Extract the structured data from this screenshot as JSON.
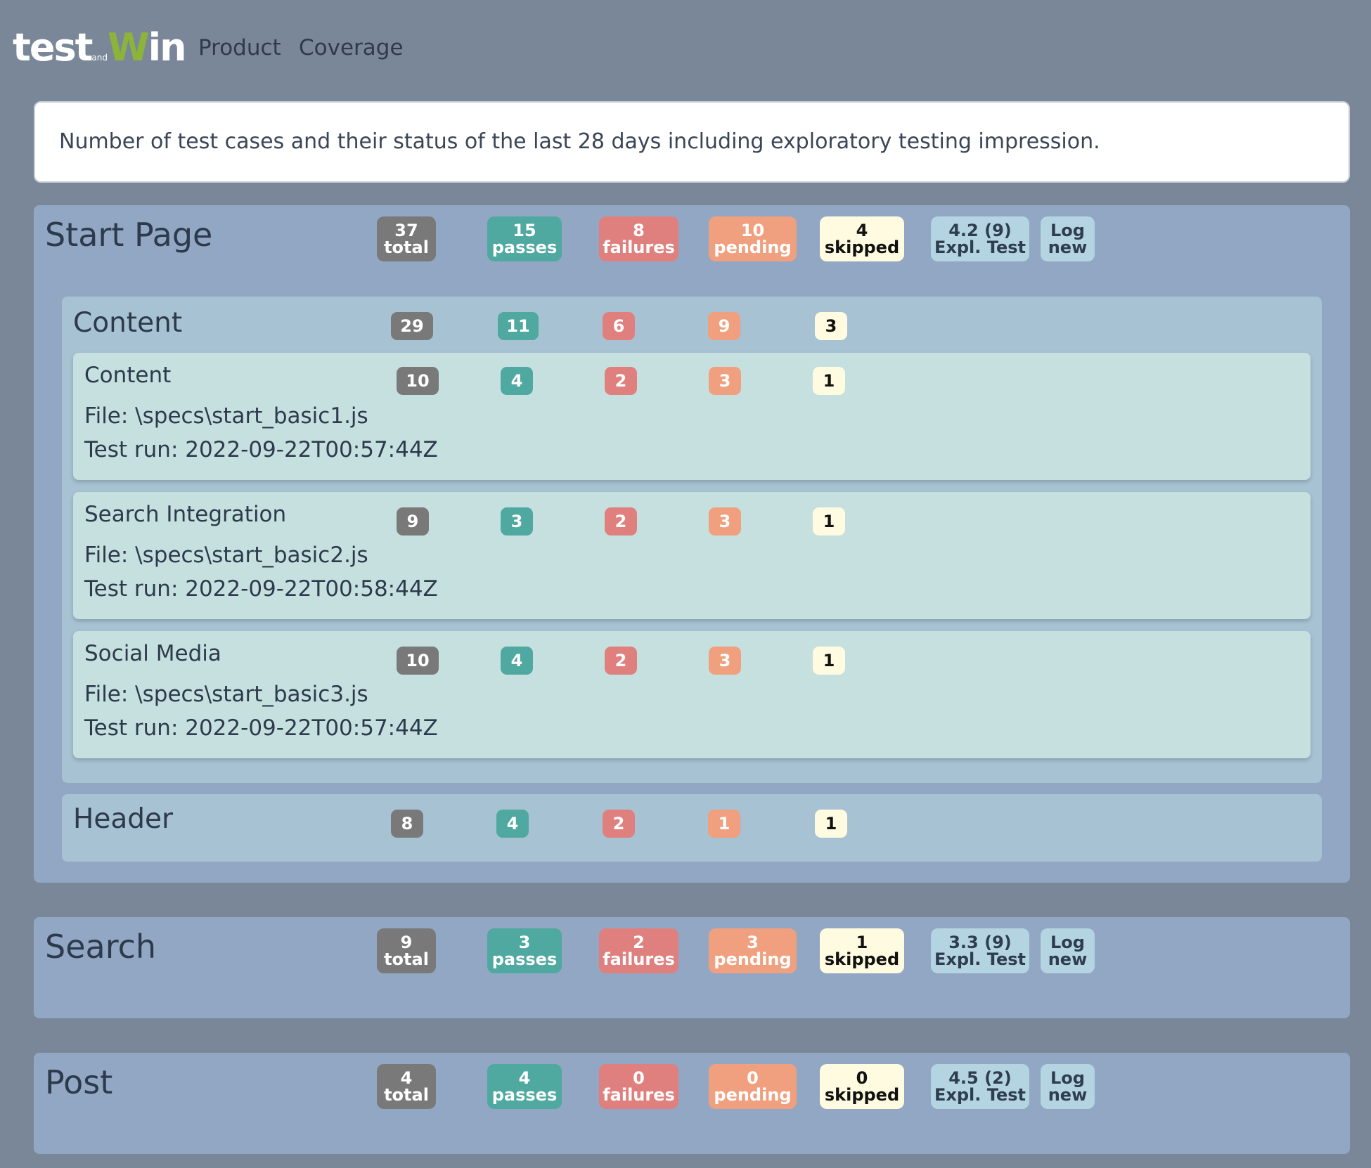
{
  "nav": {
    "logo_part1": "test",
    "logo_small": "and",
    "logo_w": "W",
    "logo_part2": "in",
    "links": [
      "Product",
      "Coverage"
    ]
  },
  "info_text": "Number of test cases and their status of the last 28 days including exploratory testing impression.",
  "sections": [
    {
      "title": "Start Page",
      "total": "37",
      "passes": "15",
      "failures": "8",
      "pending": "10",
      "skipped": "4",
      "expl_score": "4.2 (9)",
      "subgroups": [
        {
          "title": "Content",
          "total": "29",
          "passes": "11",
          "failures": "6",
          "pending": "9",
          "skipped": "3",
          "specs": [
            {
              "title": "Content",
              "file": "File: \\specs\\start_basic1.js",
              "run": "Test run: 2022-09-22T00:57:44Z",
              "total": "10",
              "passes": "4",
              "failures": "2",
              "pending": "3",
              "skipped": "1"
            },
            {
              "title": "Search Integration",
              "file": "File: \\specs\\start_basic2.js",
              "run": "Test run: 2022-09-22T00:58:44Z",
              "total": "9",
              "passes": "3",
              "failures": "2",
              "pending": "3",
              "skipped": "1"
            },
            {
              "title": "Social Media",
              "file": "File: \\specs\\start_basic3.js",
              "run": "Test run: 2022-09-22T00:57:44Z",
              "total": "10",
              "passes": "4",
              "failures": "2",
              "pending": "3",
              "skipped": "1"
            }
          ]
        },
        {
          "title": "Header",
          "total": "8",
          "passes": "4",
          "failures": "2",
          "pending": "1",
          "skipped": "1"
        }
      ]
    },
    {
      "title": "Search",
      "total": "9",
      "passes": "3",
      "failures": "2",
      "pending": "3",
      "skipped": "1",
      "expl_score": "3.3 (9)"
    },
    {
      "title": "Post",
      "total": "4",
      "passes": "4",
      "failures": "0",
      "pending": "0",
      "skipped": "0",
      "expl_score": "4.5 (2)"
    }
  ],
  "labels": {
    "total": "total",
    "passes": "passes",
    "failures": "failures",
    "pending": "pending",
    "skipped": "skipped",
    "expl": "Expl. Test",
    "log": "Log",
    "new": "new"
  },
  "colors": {
    "background": "#798799",
    "section": "#92a7c4",
    "subgroup": "#a7c2d2",
    "card": "#c6e0e0",
    "total": "#797979",
    "passes": "#4fa9a0",
    "failures": "#e0807e",
    "pending": "#f0a07e",
    "skipped": "#fffbe0",
    "expl": "#b4d4e2",
    "logo_accent": "#8db33a"
  }
}
